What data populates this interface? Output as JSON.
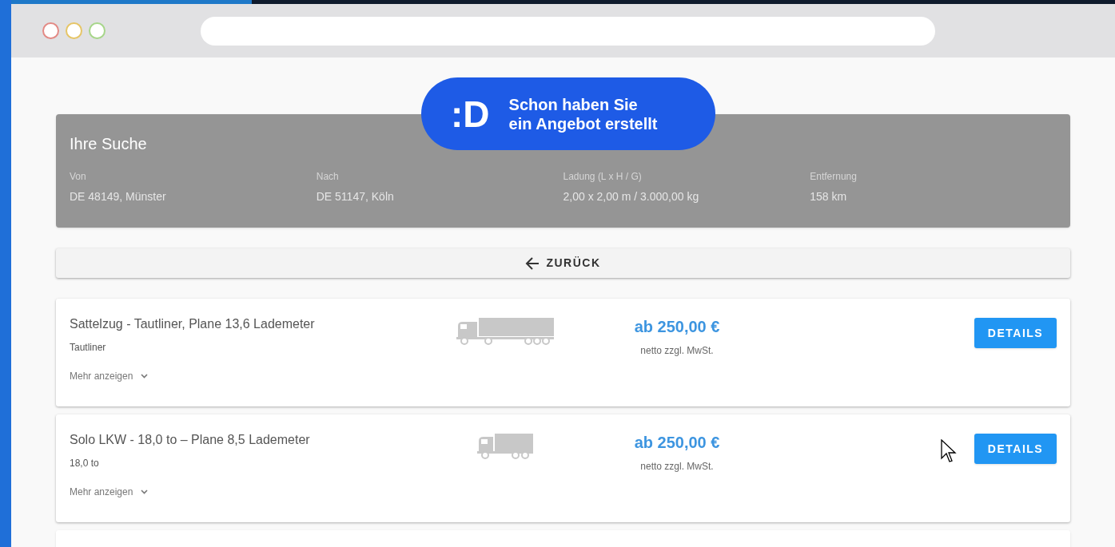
{
  "badge": {
    "mark": ":D",
    "text_lines": [
      "Schon haben Sie",
      "ein Angebot erstellt"
    ]
  },
  "search_summary": {
    "title": "Ihre Suche",
    "fields": [
      {
        "label": "Von",
        "value": "DE 48149, Münster"
      },
      {
        "label": "Nach",
        "value": "DE 51147, Köln"
      },
      {
        "label": "Ladung (L x H / G)",
        "value": "2,00 x 2,00 m / 3.000,00 kg"
      },
      {
        "label": "Entfernung",
        "value": "158 km"
      }
    ]
  },
  "back_button": {
    "label": "ZURÜCK"
  },
  "offers": [
    {
      "title": "Sattelzug - Tautliner, Plane 13,6 Lademeter",
      "subtitle": "Tautliner",
      "more": "Mehr anzeigen",
      "vehicle": {
        "kind": "semitrailer"
      },
      "price": "ab 250,00 €",
      "price_note": "netto zzgl. MwSt.",
      "button": "DETAILS"
    },
    {
      "title": "Solo LKW - 18,0 to – Plane 8,5 Lademeter",
      "subtitle": "18,0 to",
      "more": "Mehr anzeigen",
      "vehicle": {
        "kind": "rigid"
      },
      "price": "ab 250,00 €",
      "price_note": "netto zzgl. MwSt.",
      "button": "DETAILS"
    }
  ]
}
